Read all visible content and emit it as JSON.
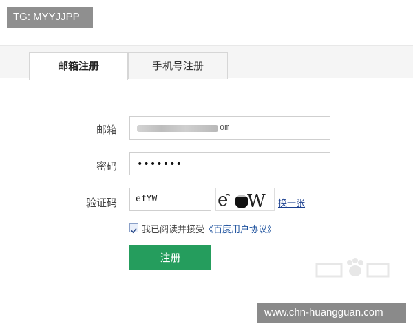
{
  "watermarks": {
    "top_left": "TG: MYYJJPP",
    "bottom_right": "www.chn-huangguan.com"
  },
  "tabs": [
    {
      "label": "邮箱注册",
      "active": true
    },
    {
      "label": "手机号注册",
      "active": false
    }
  ],
  "form": {
    "email": {
      "label": "邮箱",
      "value_tail": "om"
    },
    "password": {
      "label": "密码",
      "value": "•••••••"
    },
    "captcha": {
      "label": "验证码",
      "value": "efYW",
      "image_text": "efYW",
      "refresh_label": "换一张"
    }
  },
  "agreement": {
    "checked": true,
    "text": "我已阅读并接受",
    "link": "《百度用户协议》"
  },
  "submit_label": "注册",
  "colors": {
    "accent_green": "#259d5d",
    "link_blue": "#1a3f8f"
  }
}
